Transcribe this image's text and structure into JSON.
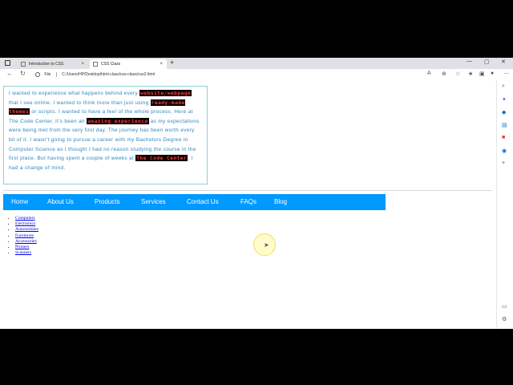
{
  "browser": {
    "tabs": [
      {
        "title": "Introduction to CSS",
        "active": false
      },
      {
        "title": "CSS Class",
        "active": true
      }
    ],
    "new_tab": "+",
    "tab_close": "×",
    "window_controls": {
      "minimize": "—",
      "maximize": "▢",
      "close": "✕"
    },
    "address": {
      "scheme_label": "File",
      "url": "C:/Users/HP/Desktop/html-class/css-class/css2.html"
    },
    "toolbar_icons": [
      "read-aloud-icon",
      "zoom-icon",
      "favorite-star-icon",
      "favorites-icon",
      "collections-icon",
      "profile-icon",
      "more-icon"
    ],
    "sidebar_icons": [
      "search-icon",
      "discover-icon",
      "shopping-icon",
      "tools-icon",
      "office-icon",
      "outlook-icon",
      "add-icon",
      "screen-icon",
      "settings-icon"
    ]
  },
  "content": {
    "paragraph": {
      "t1": "I wanted to experience what happens behind every ",
      "h1": "website/webpage",
      "t2": " that I see online. I wanted to think more than just using ",
      "h2": "ready-made themes",
      "t3": " or scripts. I wanted to have a feel of the whole process.  Here at The Code Center, it’s been an ",
      "h3": "amazing experience",
      "t4": " as my expectations were being met from the very first day. The journey has been worth every bit of it. I wasn’t going to pursue a career with my Bachelors Degree in Computer Science as I thought I had no reason studying the course in the first place. But having spent a couple of weeks at ",
      "h4": "The Code Center",
      "t5": ", I had a change of mind."
    },
    "menu": [
      "Home",
      "About Us",
      "Products",
      "Services",
      "Contact Us",
      "FAQs",
      "Blog"
    ],
    "list": [
      "Computers",
      "Electronics",
      "Automobiles",
      "Furnitures",
      "Accessories",
      "Printers",
      "Scanners"
    ]
  },
  "colors": {
    "menu_bg": "#0099ff",
    "paragraph_text": "#2e86c1",
    "highlight_text": "#ff3b3b",
    "highlight_bg": "#000000",
    "box_border": "#8ad1d8"
  }
}
